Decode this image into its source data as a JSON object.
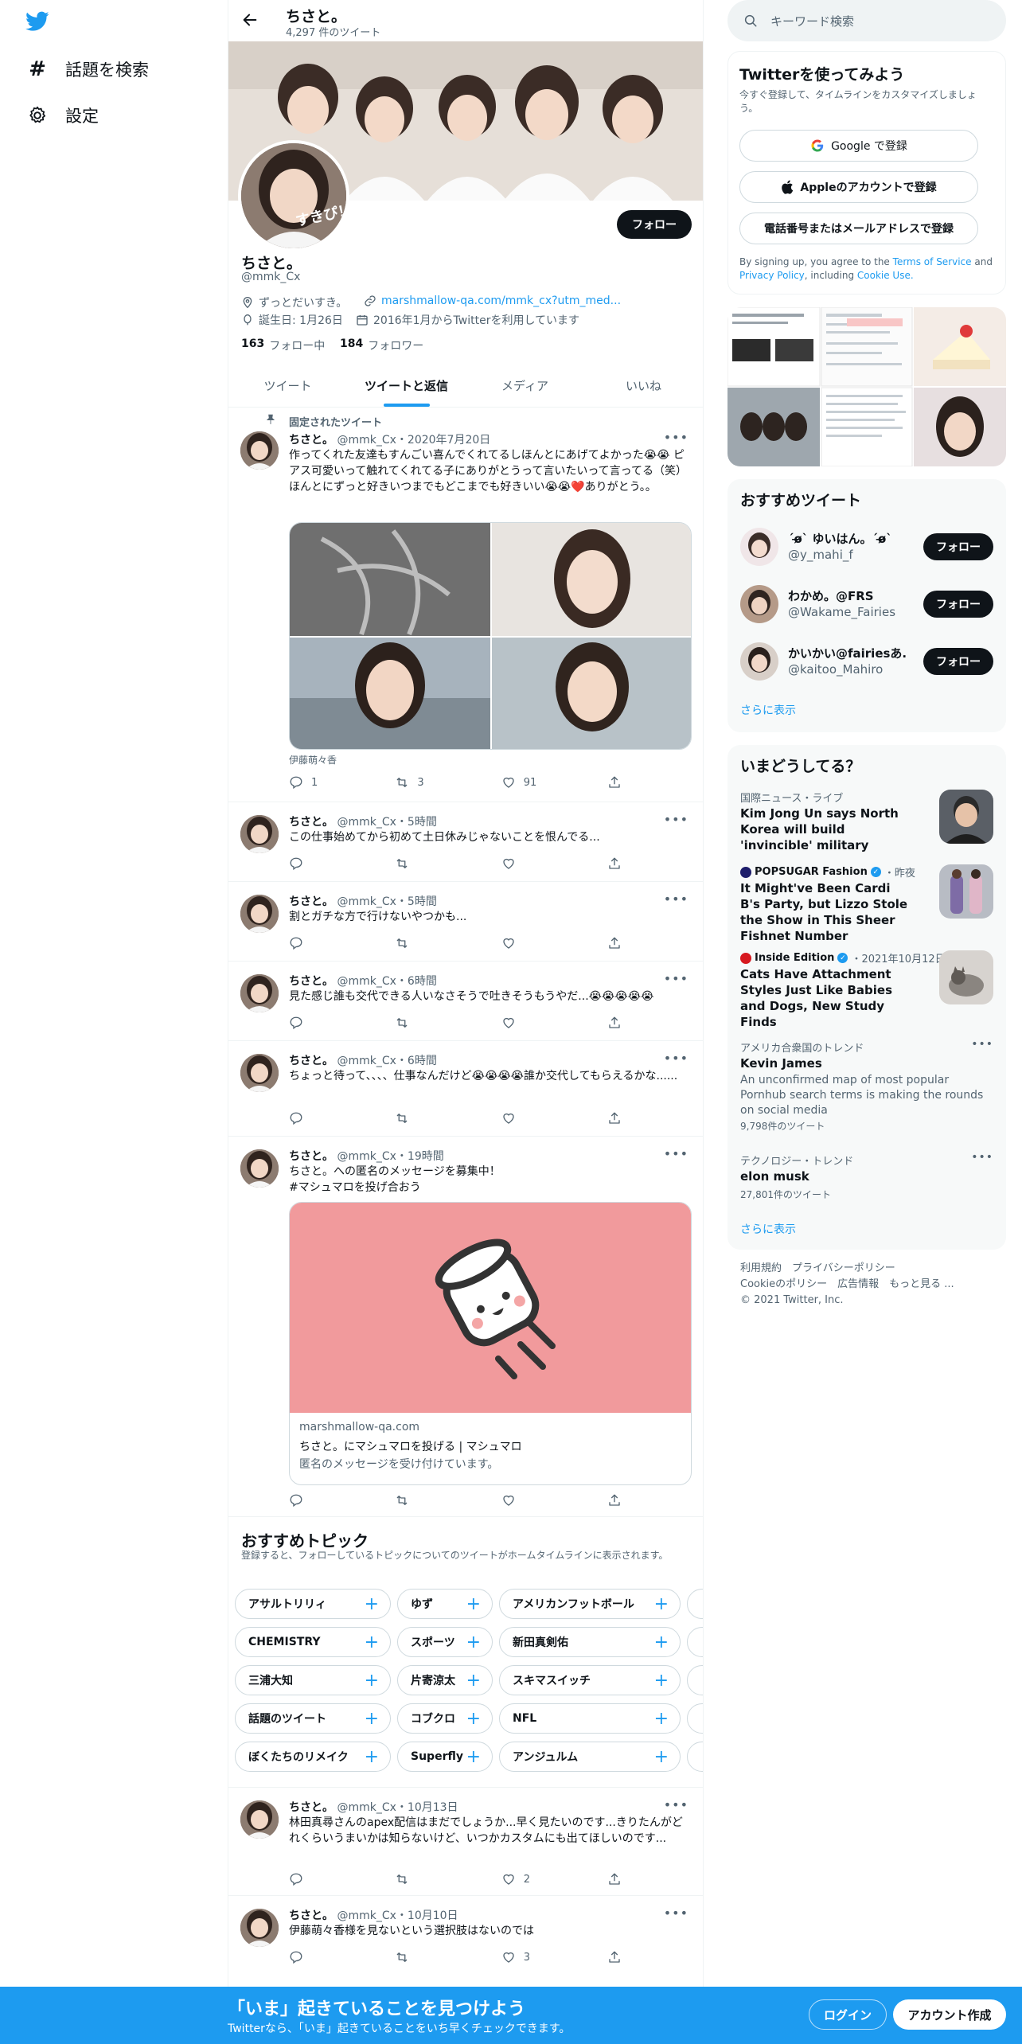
{
  "nav": {
    "explore_label": "話題を検索",
    "settings_label": "設定"
  },
  "header": {
    "name": "ちさと。",
    "tweet_count": "4,297 件のツイート"
  },
  "profile": {
    "display_name": "ちさと。",
    "handle": "@mmk_Cx",
    "avatar_text": "すきぴ！",
    "follow_label": "フォロー",
    "bio": "ずっとだいすき。",
    "website": "marshmallow-qa.com/mmk_cx?utm_med...",
    "birthday": "誕生日: 1月26日",
    "joined": "2016年1月からTwitterを利用しています",
    "following_count": "163",
    "following_label": "フォロー中",
    "followers_count": "184",
    "followers_label": "フォロワー"
  },
  "tabs": [
    "ツイート",
    "ツイートと返信",
    "メディア",
    "いいね"
  ],
  "pinned_label": "固定されたツイート",
  "tweets": [
    {
      "name": "ちさと。",
      "handle": "@mmk_Cx",
      "time": "2020年7月20日",
      "text": "作ってくれた友達もすんごい喜んでくれてるしほんとにあげてよかった😭😭 ピアス可愛いって触れてくれてる子にありがとうって言いたいって言ってる（笑）ほんとにずっと好きいつまでもどこまでも好きいい😭😭❤️ありがとう。。",
      "media_caption": "伊藤萌々香",
      "replies": "1",
      "retweets": "3",
      "likes": "91"
    },
    {
      "name": "ちさと。",
      "handle": "@mmk_Cx",
      "time": "5時間",
      "text": "この仕事始めてから初めて土日休みじゃないことを恨んでる..."
    },
    {
      "name": "ちさと。",
      "handle": "@mmk_Cx",
      "time": "5時間",
      "text": "割とガチな方で行けないやつかも..."
    },
    {
      "name": "ちさと。",
      "handle": "@mmk_Cx",
      "time": "6時間",
      "text": "見た感じ誰も交代できる人いなさそうで吐きそうもうやだ...😭😭😭😭😭"
    },
    {
      "name": "ちさと。",
      "handle": "@mmk_Cx",
      "time": "6時間",
      "text": "ちょっと待って、、、、仕事なんだけど😭😭😭😭誰か交代してもらえるかな......"
    },
    {
      "name": "ちさと。",
      "handle": "@mmk_Cx",
      "time": "19時間",
      "text": "ちさと。への匿名のメッセージを募集中！",
      "hashtag": "#マシュマロを投げ合おう",
      "card_domain": "marshmallow-qa.com",
      "card_title": "ちさと。にマシュマロを投げる | マシュマロ",
      "card_desc": "匿名のメッセージを受け付けています。"
    },
    {
      "name": "ちさと。",
      "handle": "@mmk_Cx",
      "time": "10月13日",
      "text": "林田真尋さんのapex配信はまだでしょうか...早く見たいのです...きりたんがどれくらいうまいかは知らないけど、いつかカスタムにも出てほしいのです...",
      "likes": "2"
    },
    {
      "name": "ちさと。",
      "handle": "@mmk_Cx",
      "time": "10月10日",
      "text": "伊藤萌々香様を見ないという選択肢はないのでは",
      "likes": "3"
    }
  ],
  "topics": {
    "title": "おすすめトピック",
    "subtitle": "登録すると、フォローしているトピックについてのツイートがホームタイムラインに表示されます。",
    "rows": [
      [
        "アサルトリリィ",
        "ゆず",
        "アメリカンフットボール"
      ],
      [
        "CHEMISTRY",
        "スポーツ",
        "新田真剣佑"
      ],
      [
        "三浦大知",
        "片寄涼太",
        "スキマスイッチ"
      ],
      [
        "話題のツイート",
        "コブクロ",
        "NFL"
      ],
      [
        "ぼくたちのリメイク",
        "Superfly",
        "アンジュルム"
      ]
    ]
  },
  "search": {
    "placeholder": "キーワード検索"
  },
  "signup": {
    "title": "Twitterを使ってみよう",
    "subtitle": "今すぐ登録して、タイムラインをカスタマイズしましょう。",
    "google": "Google で登録",
    "apple": "Appleのアカウントで登録",
    "phone": "電話番号またはメールアドレスで登録",
    "legal_prefix": "By signing up, you agree to the",
    "terms": "Terms of Service",
    "and": "and",
    "privacy": "Privacy Policy",
    "including": ", including",
    "cookie": "Cookie Use."
  },
  "recommended": {
    "title": "おすすめツイート",
    "items": [
      {
        "name": "ˊo̶̶̷ˋ ゆいはん。ˊo̶̶̷ˋ",
        "handle": "@y_mahi_f"
      },
      {
        "name": "わかめ。@FRS",
        "handle": "@Wakame_Fairies"
      },
      {
        "name": "かいかい@fairiesあ...",
        "handle": "@kaitoo_Mahiro"
      }
    ],
    "follow_label": "フォロー",
    "more": "さらに表示"
  },
  "trends": {
    "title": "いまどうしてる？",
    "items": [
      {
        "meta": "国際ニュース・ライブ",
        "title": "Kim Jong Un says North Korea will build 'invincible' military"
      },
      {
        "meta_source": "POPSUGAR Fashion",
        "meta_time": "・昨夜",
        "title": "It Might've Been Cardi B's Party, but Lizzo Stole the Show in This Sheer Fishnet Number"
      },
      {
        "meta_source": "Inside Edition",
        "meta_time": "・2021年10月12日",
        "title": "Cats Have Attachment Styles Just Like Babies and Dogs, New Study Finds"
      },
      {
        "meta": "アメリカ合衆国のトレンド",
        "title": "Kevin James",
        "desc": "An unconfirmed map of most popular Pornhub search terms is making the rounds on social media",
        "count": "9,798件のツイート"
      },
      {
        "meta": "テクノロジー・トレンド",
        "title": "elon musk",
        "count": "27,801件のツイート"
      }
    ],
    "more": "さらに表示"
  },
  "footer": {
    "line1": "利用規約　プライバシーポリシー",
    "line2": "Cookieのポリシー　広告情報　もっと見る ...",
    "line3": "© 2021 Twitter, Inc."
  },
  "bottom_bar": {
    "title": "「いま」起きていることを見つけよう",
    "subtitle": "Twitterなら、「いま」起きていることをいち早くチェックできます。",
    "login": "ログイン",
    "signup": "アカウント作成"
  },
  "colors": {
    "accent": "#1d9bf0",
    "text": "#0f1419",
    "muted": "#536471",
    "card_bg": "#f7f9f9",
    "marshmallow_bg": "#f19a9c"
  }
}
